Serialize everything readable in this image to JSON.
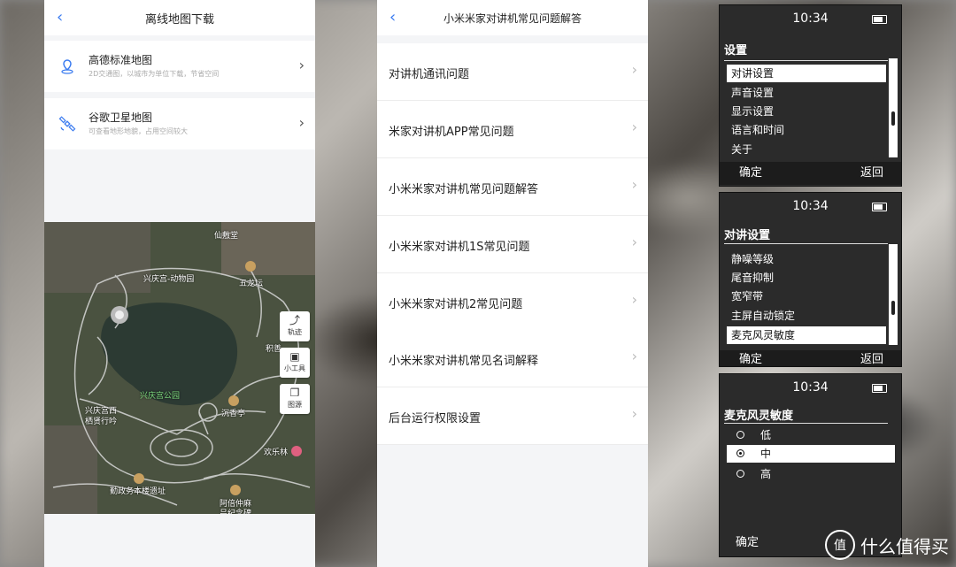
{
  "offline_map": {
    "title": "离线地图下载",
    "items": [
      {
        "title": "高德标准地图",
        "subtitle": "2D交通图，以城市为单位下载，节省空间",
        "icon": "location-pin-icon"
      },
      {
        "title": "谷歌卫星地图",
        "subtitle": "可查看地形地貌，占用空间较大",
        "icon": "satellite-icon"
      }
    ],
    "map_buttons": [
      {
        "label": "轨迹",
        "icon": "track-icon"
      },
      {
        "label": "小工具",
        "icon": "toolbox-icon"
      },
      {
        "label": "图源",
        "icon": "layers-icon"
      }
    ],
    "map_labels": [
      "仙敷堂",
      "兴庆宫-动物园",
      "五龙坛",
      "兴庆宫公园",
      "兴庆宫西",
      "栖贤行吟",
      "沉香亭",
      "欢乐林",
      "勤政务本楼遗址",
      "阿倍仲麻",
      "吕纪念碑",
      "积善"
    ]
  },
  "faq": {
    "title": "小米米家对讲机常见问题解答",
    "items": [
      "对讲机通讯问题",
      "米家对讲机APP常见问题",
      "小米米家对讲机常见问题解答",
      "小米米家对讲机1S常见问题",
      "小米米家对讲机2常见问题",
      "小米米家对讲机常见名词解释",
      "后台运行权限设置"
    ]
  },
  "device": {
    "time": "10:34",
    "screen1": {
      "title": "设置",
      "items": [
        "对讲设置",
        "声音设置",
        "显示设置",
        "语言和时间",
        "关于"
      ],
      "selected": 0,
      "ok": "确定",
      "back": "返回"
    },
    "screen2": {
      "title": "对讲设置",
      "items": [
        "静噪等级",
        "尾音抑制",
        "宽窄带",
        "主屏自动锁定",
        "麦克风灵敏度"
      ],
      "selected": 4,
      "ok": "确定",
      "back": "返回"
    },
    "screen3": {
      "title": "麦克风灵敏度",
      "options": [
        "低",
        "中",
        "高"
      ],
      "selected": 1,
      "ok": "确定"
    }
  },
  "watermark": {
    "logo": "值",
    "text": "什么值得买"
  },
  "colors": {
    "accent": "#3a7bf0",
    "device_bg": "#2b2b2b"
  }
}
